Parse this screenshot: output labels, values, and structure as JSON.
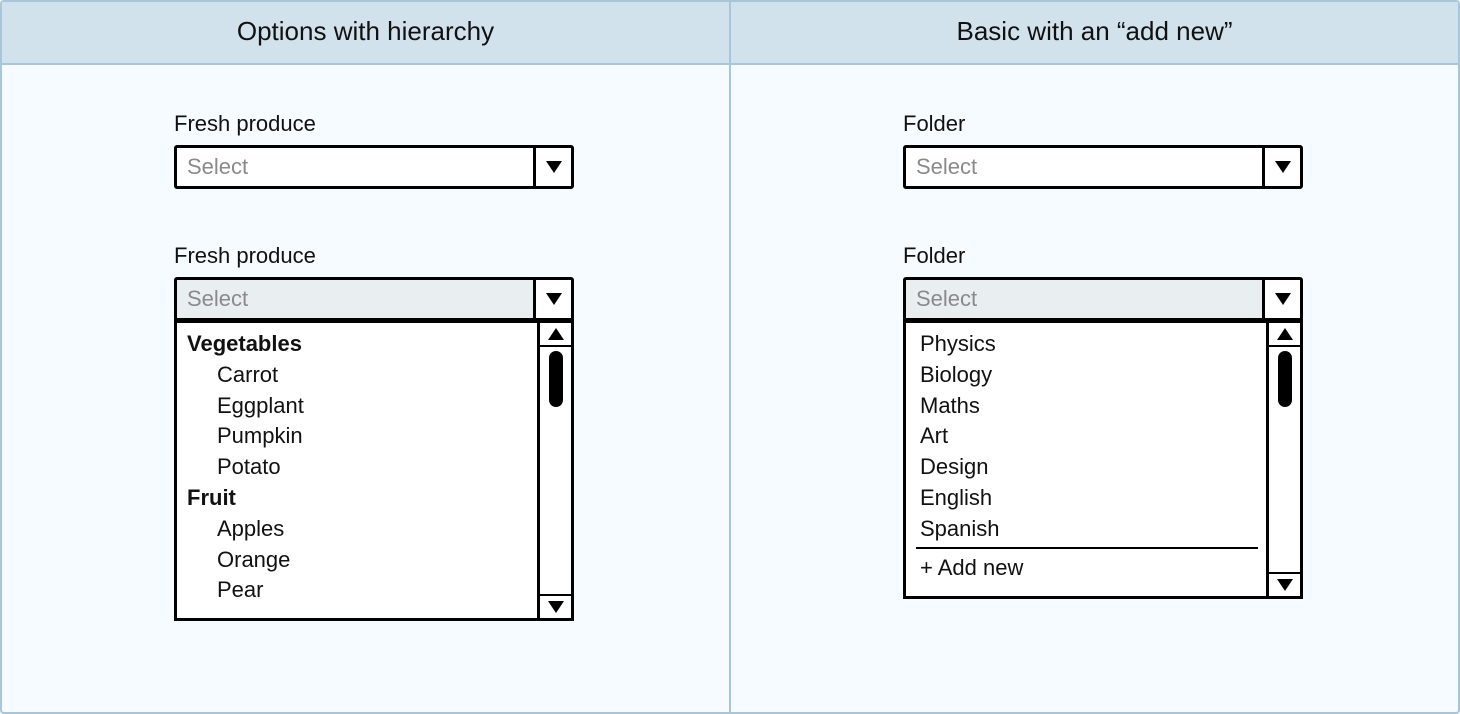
{
  "left": {
    "header": "Options with hierarchy",
    "label": "Fresh produce",
    "placeholder": "Select",
    "groups": [
      {
        "title": "Vegetables",
        "items": [
          "Carrot",
          "Eggplant",
          "Pumpkin",
          "Potato"
        ]
      },
      {
        "title": "Fruit",
        "items": [
          "Apples",
          "Orange",
          "Pear"
        ]
      }
    ]
  },
  "right": {
    "header": "Basic with an “add new”",
    "label": "Folder",
    "placeholder": "Select",
    "items": [
      "Physics",
      "Biology",
      "Maths",
      "Art",
      "Design",
      "English",
      "Spanish"
    ],
    "addNew": "+ Add new"
  }
}
